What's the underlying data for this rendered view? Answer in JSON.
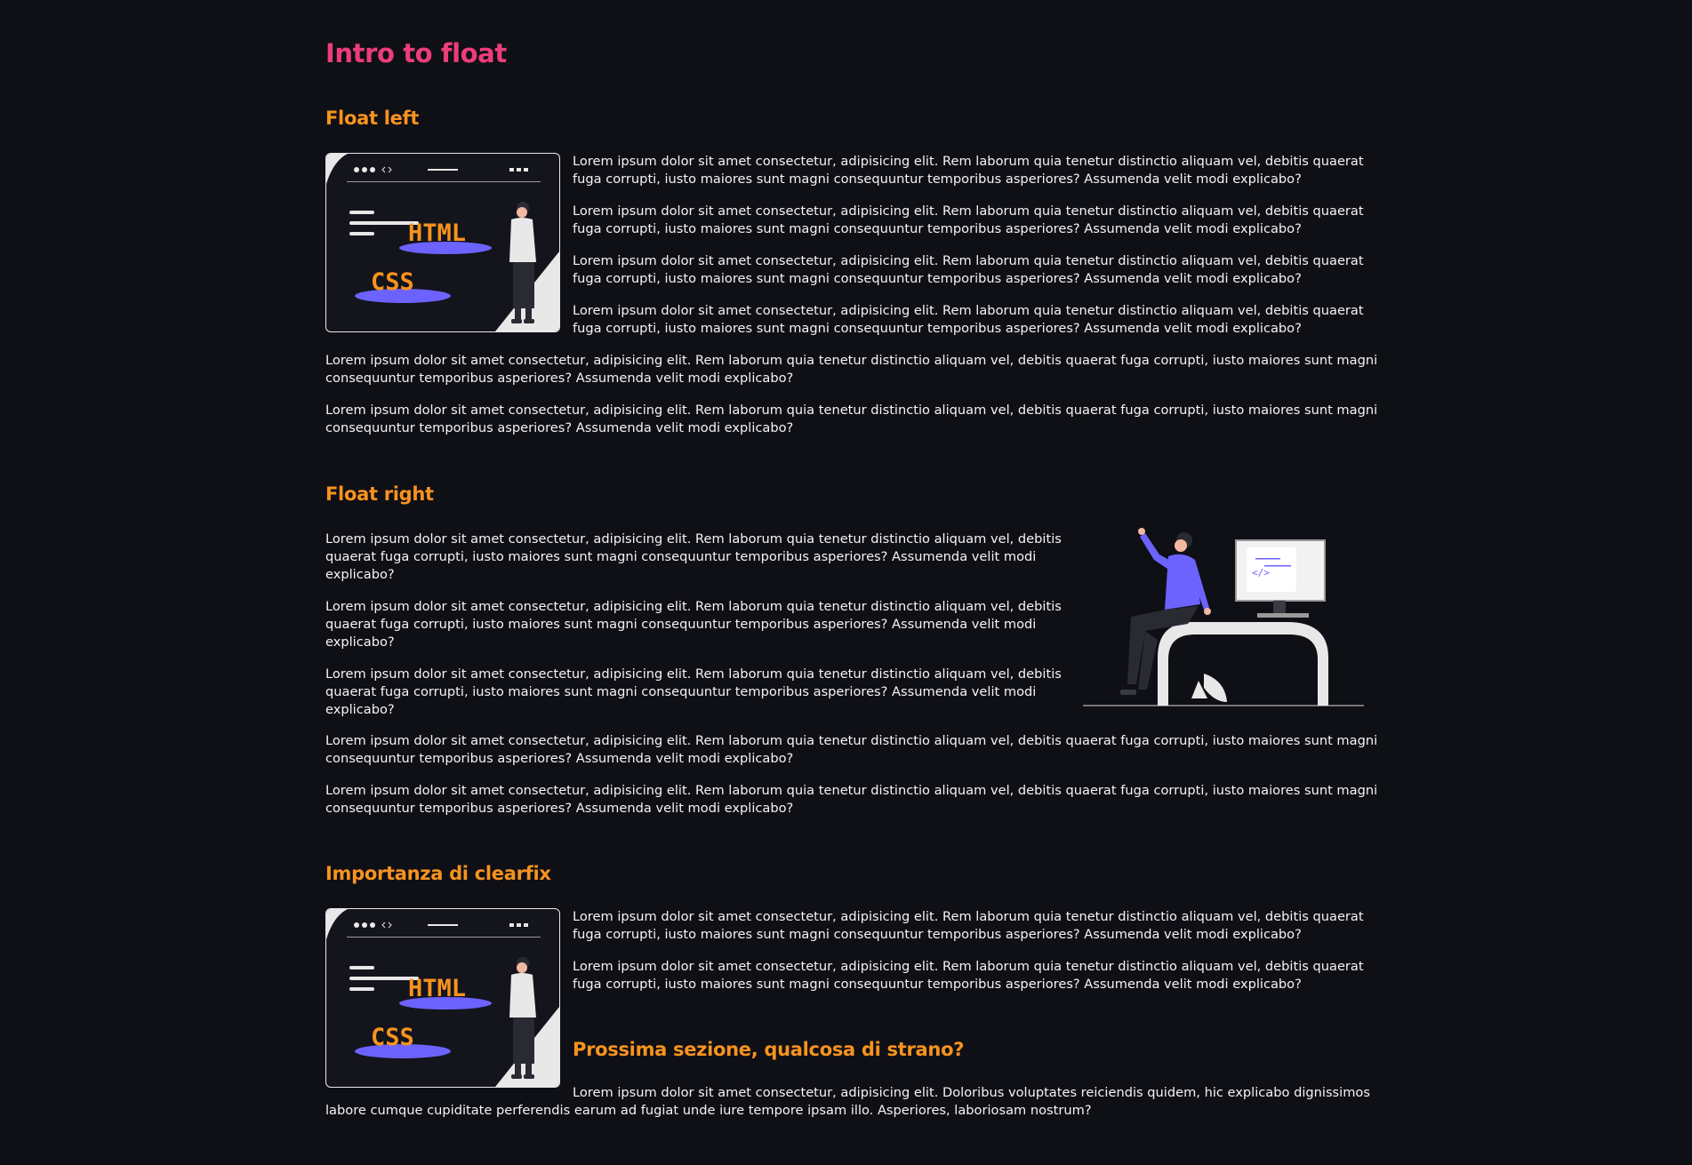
{
  "page": {
    "title": "Intro to float"
  },
  "sections": {
    "float_left": {
      "heading": "Float left",
      "p1": [
        "Lorem ipsum dolor sit amet consectetur, adipisicing elit. Rem laborum quia tenetur distinctio aliquam vel, debitis quaerat",
        "fuga corrupti, iusto maiores sunt magni consequuntur temporibus asperiores? Assumenda velit modi explicabo?"
      ],
      "full": [
        "Lorem ipsum dolor sit amet consectetur, adipisicing elit. Rem laborum quia tenetur distinctio aliquam vel, debitis quaerat fuga corrupti, iusto maiores sunt magni",
        "consequuntur temporibus asperiores? Assumenda velit modi explicabo?"
      ]
    },
    "float_right": {
      "heading": "Float right",
      "narrow": [
        "Lorem ipsum dolor sit amet consectetur, adipisicing elit. Rem laborum quia tenetur distinctio aliquam vel, debitis",
        "quaerat fuga corrupti, iusto maiores sunt magni consequuntur temporibus asperiores? Assumenda velit modi",
        "explicabo?"
      ],
      "full": [
        "Lorem ipsum dolor sit amet consectetur, adipisicing elit. Rem laborum quia tenetur distinctio aliquam vel, debitis quaerat fuga corrupti, iusto maiores sunt magni",
        "consequuntur temporibus asperiores? Assumenda velit modi explicabo?"
      ]
    },
    "clearfix": {
      "heading": "Importanza di clearfix",
      "p1": [
        "Lorem ipsum dolor sit amet consectetur, adipisicing elit. Rem laborum quia tenetur distinctio aliquam vel, debitis quaerat",
        "fuga corrupti, iusto maiores sunt magni consequuntur temporibus asperiores? Assumenda velit modi explicabo?"
      ],
      "next_heading": "Prossima sezione, qualcosa di strano?",
      "next_para": [
        "Lorem ipsum dolor sit amet consectetur, adipisicing elit. Doloribus voluptates reiciendis quidem, hic explicabo dignissimos",
        "labore cumque cupiditate perferendis earum ad fugiat unde iure tempore ipsam illo. Asperiores, laboriosam nostrum?"
      ]
    }
  },
  "illustration": {
    "html_label": "HTML",
    "css_label": "CSS",
    "code_label": "</>"
  },
  "colors": {
    "background": "#0f0f16",
    "title": "#ec3d78",
    "heading": "#f7931e",
    "accent": "#6c63ff"
  }
}
